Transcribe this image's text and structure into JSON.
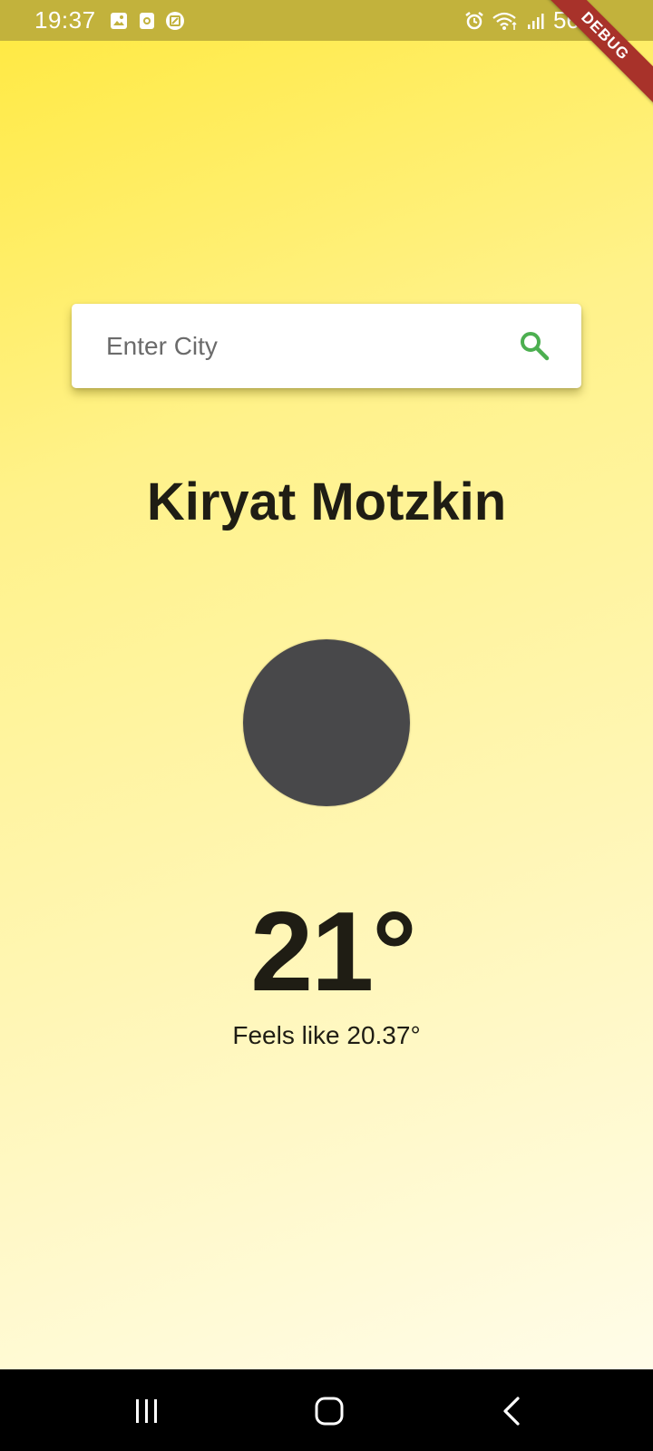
{
  "status_bar": {
    "time": "19:37",
    "battery": "56%",
    "left_icons": [
      "gallery-icon",
      "recorder-icon",
      "app-icon"
    ],
    "right_icons": [
      "alarm-icon",
      "wifi-icon",
      "signal-icon",
      "battery-icon"
    ]
  },
  "debug_banner": "DEBUG",
  "search": {
    "placeholder": "Enter City",
    "value": "",
    "icon": "search-icon",
    "icon_color": "#4caf50"
  },
  "weather": {
    "city": "Kiryat Motzkin",
    "temperature": "21°",
    "feels_like": "Feels like 20.37°",
    "icon_color": "#48484a"
  },
  "nav_bar": {
    "buttons": [
      "recents",
      "home",
      "back"
    ]
  },
  "colors": {
    "status_bar": "#c2b23c",
    "gradient_top": "#ffe93f",
    "gradient_bottom": "#fffdf0",
    "text": "#1f1d14"
  }
}
